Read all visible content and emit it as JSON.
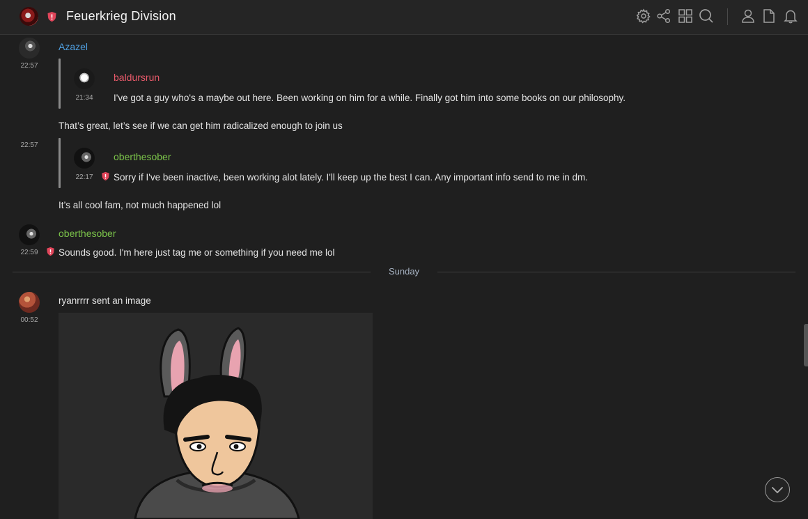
{
  "header": {
    "server_name": "Feuerkrieg Division",
    "icons": [
      "settings-icon",
      "share-icon",
      "grid-icon",
      "search-icon",
      "user-icon",
      "document-icon",
      "bell-icon"
    ]
  },
  "messages": {
    "m1": {
      "author": "Azazel",
      "time": "22:57",
      "quote": {
        "author": "baldursrun",
        "time": "21:34",
        "text": "I've got a guy who's a maybe out here. Been working on him for a while. Finally got him into some books on our philosophy."
      },
      "text": "That’s great, let’s see if we can get him radicalized enough to join us"
    },
    "m2": {
      "time": "22:57",
      "quote": {
        "author": "oberthesober",
        "time": "22:17",
        "text": "Sorry if I've been inactive, been working alot lately. I'll keep up the best I can. Any important info send to me in dm."
      },
      "text": "It’s all cool fam, not much happened lol"
    },
    "m3": {
      "author": "oberthesober",
      "time": "22:59",
      "text": "Sounds good. I'm here just tag me or something if you need me lol"
    }
  },
  "day_separator": "Sunday",
  "image_message": {
    "sender": "ryanrrrr",
    "action_text": "ryanrrrr sent an image",
    "time": "00:52"
  },
  "colors": {
    "azazel": "#4f9fe0",
    "baldursrun": "#e85a6a",
    "oberthesober": "#7bc34a",
    "warning_red": "#e0455a"
  }
}
